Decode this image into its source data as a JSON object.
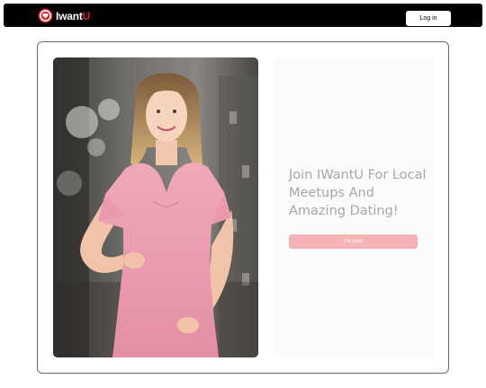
{
  "header": {
    "logo": {
      "text_primary": "IwantU",
      "icon": "heart-badge-icon",
      "accent_color": "#d8202a"
    },
    "login_label": "Log in"
  },
  "hero": {
    "image": "smiling-woman-pink-dress-photo",
    "headline": "Join IWantU For Local Meetups And Amazing Dating!",
    "cta_label": "I'm new",
    "cta_color": "#f6b3b7"
  }
}
